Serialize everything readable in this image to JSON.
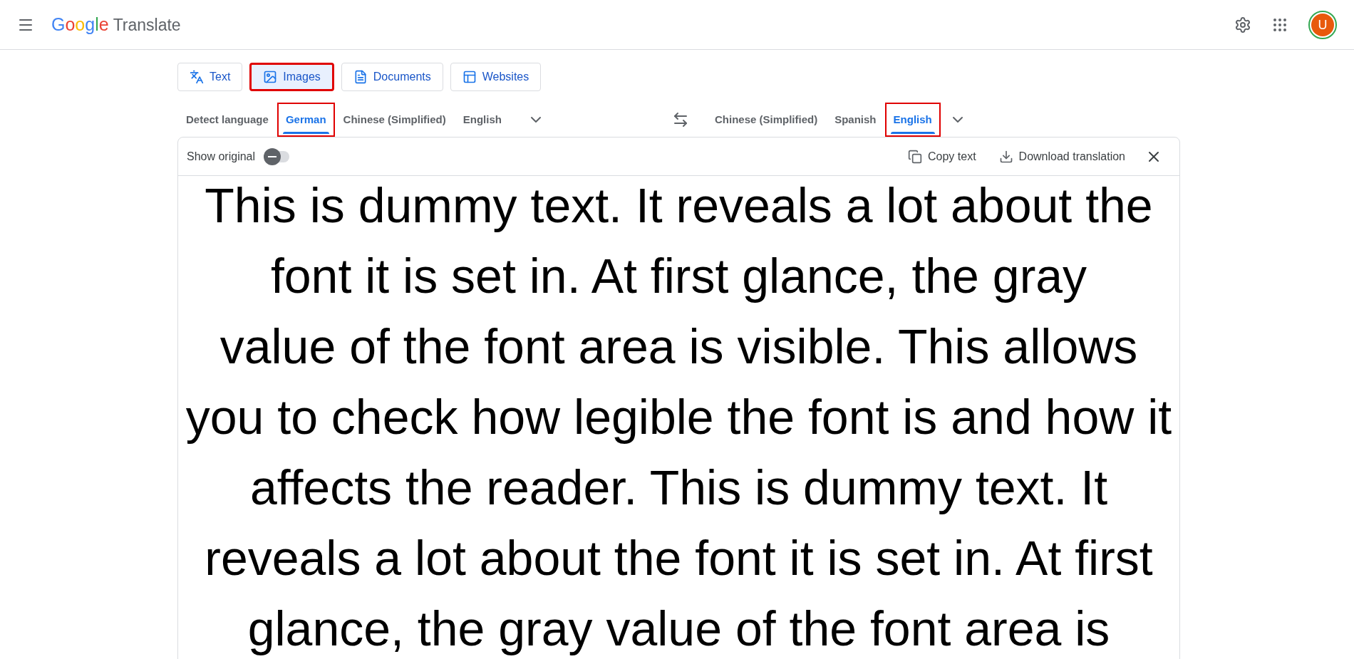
{
  "header": {
    "logo": "Google",
    "product": "Translate",
    "avatar": "U"
  },
  "modes": [
    {
      "label": "Text",
      "selected": false,
      "highlighted": false
    },
    {
      "label": "Images",
      "selected": true,
      "highlighted": true
    },
    {
      "label": "Documents",
      "selected": false,
      "highlighted": false
    },
    {
      "label": "Websites",
      "selected": false,
      "highlighted": false
    }
  ],
  "source_languages": [
    {
      "label": "Detect language",
      "selected": false,
      "highlighted": false
    },
    {
      "label": "German",
      "selected": true,
      "highlighted": true
    },
    {
      "label": "Chinese (Simplified)",
      "selected": false,
      "highlighted": false
    },
    {
      "label": "English",
      "selected": false,
      "highlighted": false
    }
  ],
  "target_languages": [
    {
      "label": "Chinese (Simplified)",
      "selected": false,
      "highlighted": false
    },
    {
      "label": "Spanish",
      "selected": false,
      "highlighted": false
    },
    {
      "label": "English",
      "selected": true,
      "highlighted": true
    }
  ],
  "toolbar": {
    "show_original": {
      "label": "Show original",
      "on": false
    },
    "copy": "Copy text",
    "download": "Download translation"
  },
  "translated_image_lines": [
    "This is dummy text. It reveals a lot about the",
    "font it is set in. At first glance, the gray",
    "value of the font area is visible. This allows",
    "you to check how legible the font is and how it",
    "affects the reader. This is dummy text. It",
    "reveals a lot about the font it is set in. At first",
    "glance, the gray value of the font area is"
  ]
}
